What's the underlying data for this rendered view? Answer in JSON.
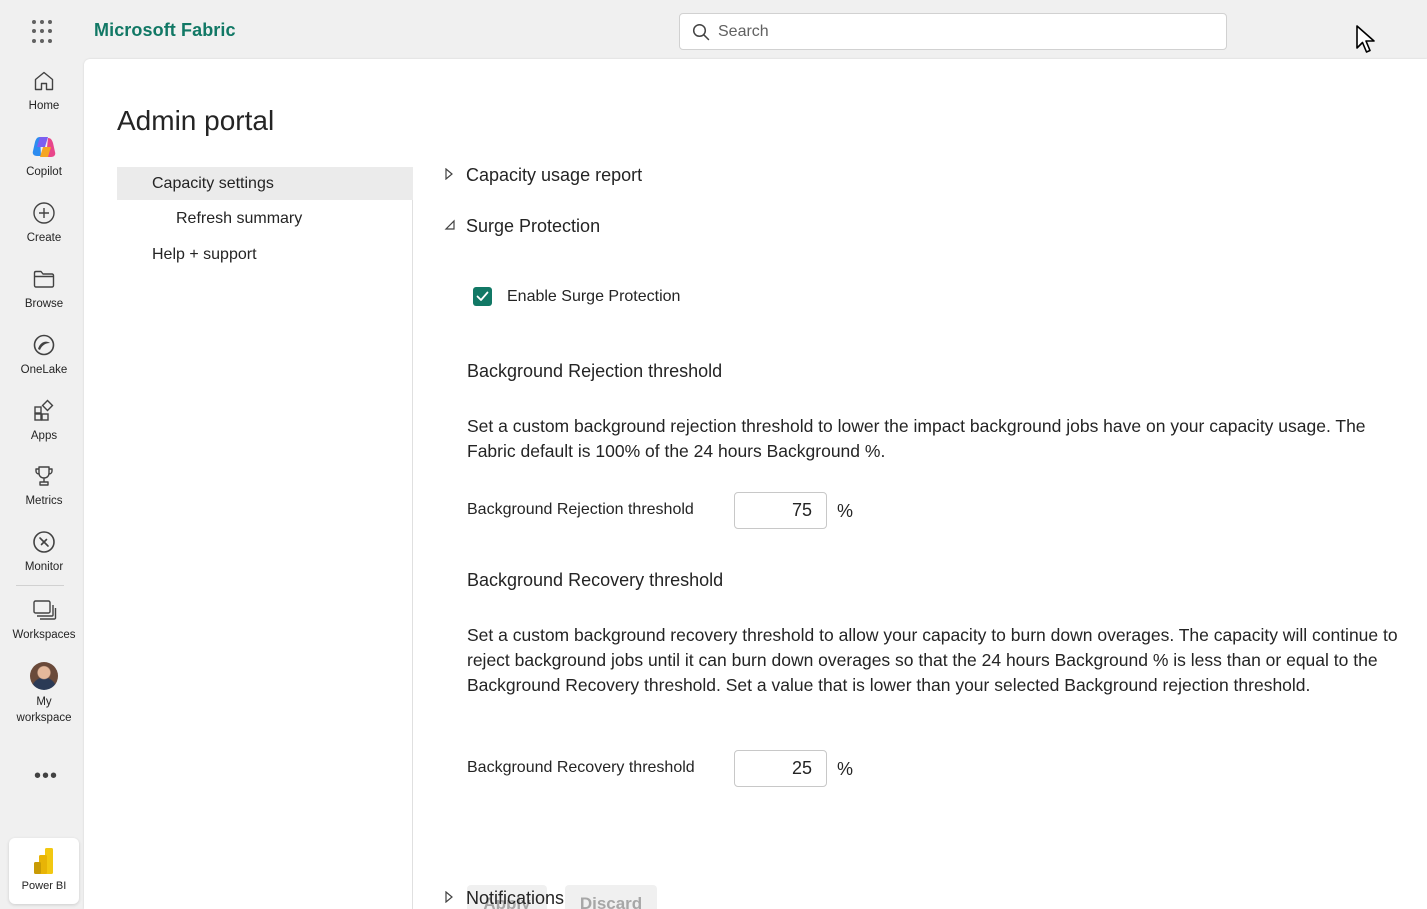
{
  "header": {
    "brand": "Microsoft Fabric",
    "search_placeholder": "Search"
  },
  "rail": {
    "items": [
      {
        "label": "Home",
        "icon": "home-icon"
      },
      {
        "label": "Copilot",
        "icon": "copilot-icon"
      },
      {
        "label": "Create",
        "icon": "plus-circle-icon"
      },
      {
        "label": "Browse",
        "icon": "folder-icon"
      },
      {
        "label": "OneLake",
        "icon": "onelake-icon"
      },
      {
        "label": "Apps",
        "icon": "apps-icon"
      },
      {
        "label": "Metrics",
        "icon": "trophy-icon"
      },
      {
        "label": "Monitor",
        "icon": "monitor-icon"
      },
      {
        "label": "Workspaces",
        "icon": "workspaces-icon"
      },
      {
        "label": "My workspace",
        "icon": "avatar"
      }
    ],
    "more": "•••",
    "power_bi": "Power BI"
  },
  "page": {
    "title": "Admin portal"
  },
  "sidenav": {
    "items": [
      {
        "label": "Capacity settings",
        "active": true
      },
      {
        "label": "Refresh summary",
        "active": false
      },
      {
        "label": "Help + support",
        "active": false
      }
    ]
  },
  "sections": {
    "usage_report": "Capacity usage report",
    "surge": "Surge Protection",
    "notifications": "Notifications"
  },
  "surge": {
    "enable_label": "Enable Surge Protection",
    "enabled": true,
    "rejection": {
      "heading": "Background Rejection threshold",
      "description": "Set a custom background rejection threshold to lower the impact background jobs have on your capacity usage. The Fabric default is 100% of the 24 hours Background %.",
      "field_label": "Background Rejection threshold",
      "value": "75",
      "unit": "%"
    },
    "recovery": {
      "heading": "Background Recovery threshold",
      "description": "Set a custom background recovery threshold to allow your capacity to burn down overages. The capacity will continue to reject background jobs until it can burn down overages so that the 24 hours Background % is less than or equal to the Background Recovery threshold. Set a value that is lower than your selected Background rejection threshold.",
      "field_label": "Background Recovery threshold",
      "value": "25",
      "unit": "%"
    }
  },
  "actions": {
    "apply": "Apply",
    "discard": "Discard"
  },
  "colors": {
    "accent": "#117865",
    "background": "#f0f0f0"
  }
}
